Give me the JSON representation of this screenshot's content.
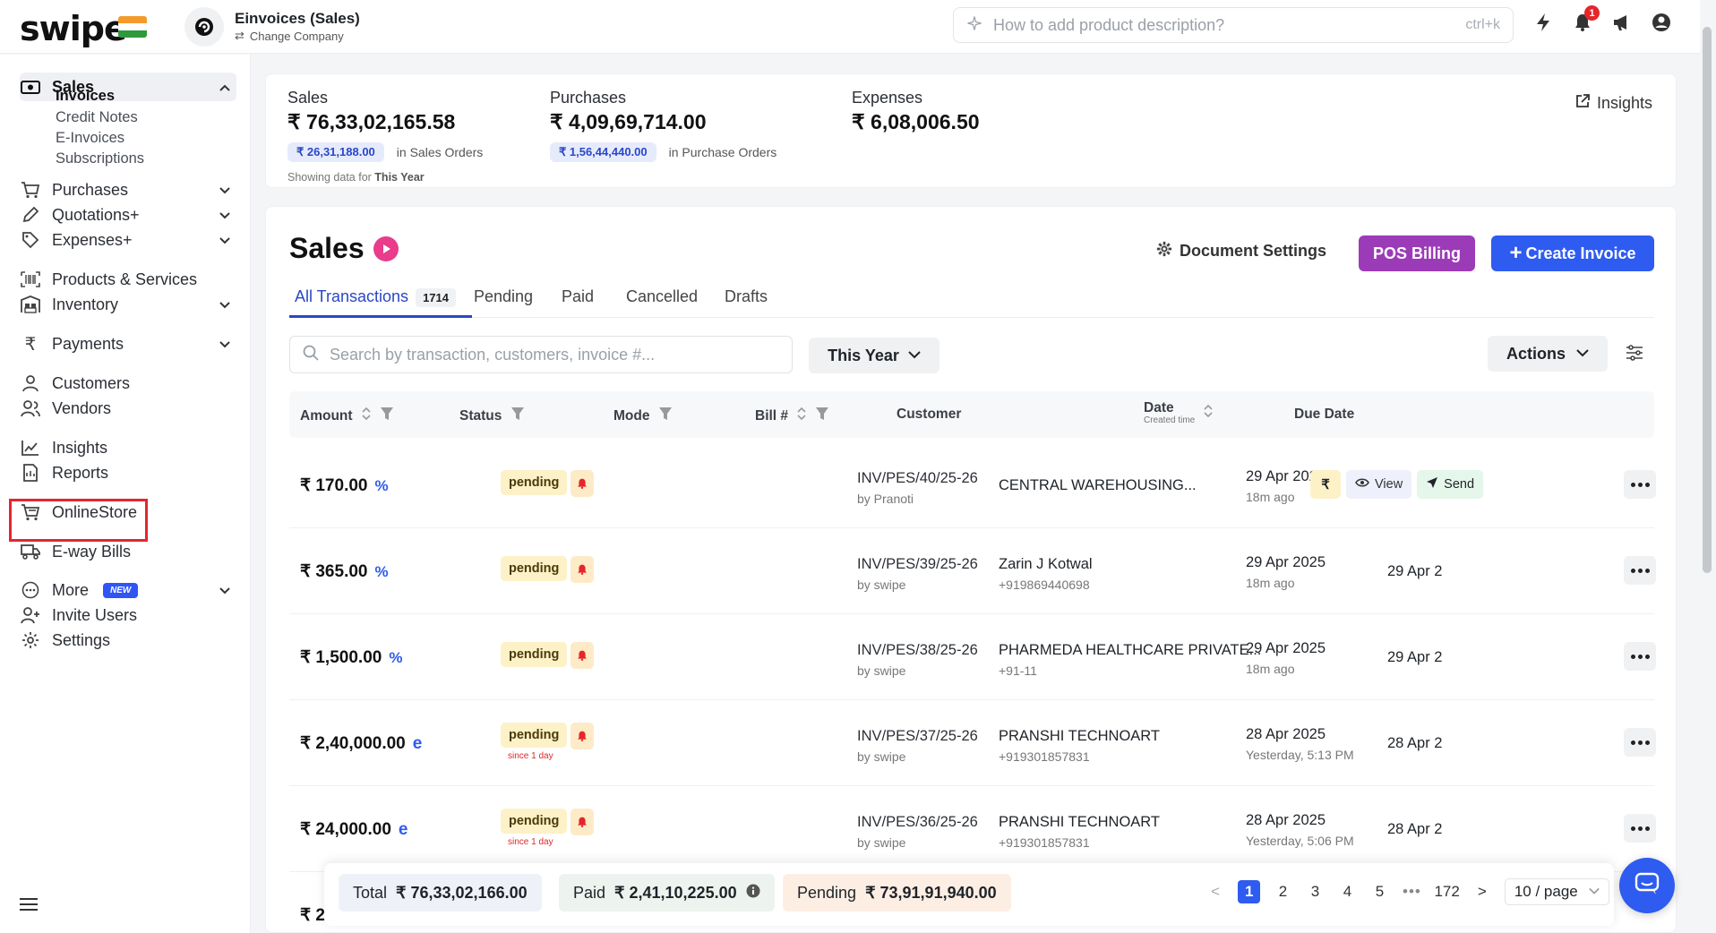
{
  "brand": {
    "logo_text": "swipe"
  },
  "company": {
    "name": "Einvoices (Sales)",
    "change_label": "Change Company"
  },
  "top_search": {
    "placeholder": "How to add product description?",
    "shortcut": "ctrl+k"
  },
  "notifications": {
    "count": "1"
  },
  "sidebar": {
    "sales": "Sales",
    "sales_sub": [
      "Invoices",
      "Credit Notes",
      "E-Invoices",
      "Subscriptions"
    ],
    "purchases": "Purchases",
    "quotations": "Quotations+",
    "expenses": "Expenses+",
    "products": "Products & Services",
    "inventory": "Inventory",
    "payments": "Payments",
    "customers": "Customers",
    "vendors": "Vendors",
    "insights": "Insights",
    "reports": "Reports",
    "onlinestore": "OnlineStore",
    "eway": "E-way Bills",
    "more": "More",
    "more_badge": "NEW",
    "invite": "Invite Users",
    "settings": "Settings"
  },
  "summary": {
    "sales_label": "Sales",
    "sales_value": "₹ 76,33,02,165.58",
    "sales_orders_value": "₹ 26,31,188.00",
    "sales_orders_label": "in Sales Orders",
    "purchases_label": "Purchases",
    "purchases_value": "₹ 4,09,69,714.00",
    "purchase_orders_value": "₹ 1,56,44,440.00",
    "purchase_orders_label": "in Purchase Orders",
    "expenses_label": "Expenses",
    "expenses_value": "₹ 6,08,006.50",
    "note_prefix": "Showing data for",
    "note_period": "This Year",
    "insights_link": "Insights"
  },
  "main": {
    "title": "Sales",
    "doc_settings": "Document Settings",
    "pos_billing": "POS Billing",
    "create_invoice": "Create Invoice",
    "tabs": [
      "All Transactions",
      "Pending",
      "Paid",
      "Cancelled",
      "Drafts"
    ],
    "all_count": "1714",
    "search_placeholder": "Search by transaction, customers, invoice #...",
    "period": "This Year",
    "actions": "Actions"
  },
  "table": {
    "headers": {
      "amount": "Amount",
      "status": "Status",
      "mode": "Mode",
      "bill": "Bill #",
      "customer": "Customer",
      "date": "Date",
      "date_sub": "Created time",
      "due": "Due Date"
    },
    "rows": [
      {
        "amount": "₹ 170.00",
        "status": "pending",
        "since": "",
        "bill": "INV/PES/40/25-26",
        "by": "by Pranoti",
        "customer": "CENTRAL WAREHOUSING...",
        "phone": "",
        "date": "29 Apr 202",
        "ago": "18m ago",
        "due": ""
      },
      {
        "amount": "₹ 365.00",
        "status": "pending",
        "since": "",
        "bill": "INV/PES/39/25-26",
        "by": "by swipe",
        "customer": "Zarin J Kotwal",
        "phone": "+919869440698",
        "date": "29 Apr 2025",
        "ago": "18m ago",
        "due": "29 Apr 2"
      },
      {
        "amount": "₹ 1,500.00",
        "status": "pending",
        "since": "",
        "bill": "INV/PES/38/25-26",
        "by": "by swipe",
        "customer": "PHARMEDA HEALTHCARE PRIVATE...",
        "phone": "+91-11",
        "date": "29 Apr 2025",
        "ago": "18m ago",
        "due": "29 Apr 2"
      },
      {
        "amount": "₹ 2,40,000.00",
        "status": "pending",
        "since": "since 1 day",
        "bill": "INV/PES/37/25-26",
        "by": "by swipe",
        "customer": "PRANSHI TECHNOART",
        "phone": "+919301857831",
        "date": "28 Apr 2025",
        "ago": "Yesterday, 5:13 PM",
        "due": "28 Apr 2"
      },
      {
        "amount": "₹ 24,000.00",
        "status": "pending",
        "since": "since 1 day",
        "bill": "INV/PES/36/25-26",
        "by": "by swipe",
        "customer": "PRANSHI TECHNOART",
        "phone": "+919301857831",
        "date": "28 Apr 2025",
        "ago": "Yesterday, 5:06 PM",
        "due": "28 Apr 2"
      }
    ],
    "row_actions": {
      "rupee": "₹",
      "view": "View",
      "send": "Send"
    },
    "partial_row_amount": "₹ 2,"
  },
  "footer": {
    "total_label": "Total",
    "total_value": "₹ 76,33,02,166.00",
    "paid_label": "Paid",
    "paid_value": "₹ 2,41,10,225.00",
    "pending_label": "Pending",
    "pending_value": "₹ 73,91,91,940.00",
    "pages": [
      "1",
      "2",
      "3",
      "4",
      "5"
    ],
    "ellipsis": "•••",
    "last_page": "172",
    "per_page": "10 / page"
  },
  "colors": {
    "primary": "#2e5bf0",
    "pos": "#9c3bb7",
    "pending_bg": "#fdf1c7",
    "highlight_border": "#e3262e"
  }
}
